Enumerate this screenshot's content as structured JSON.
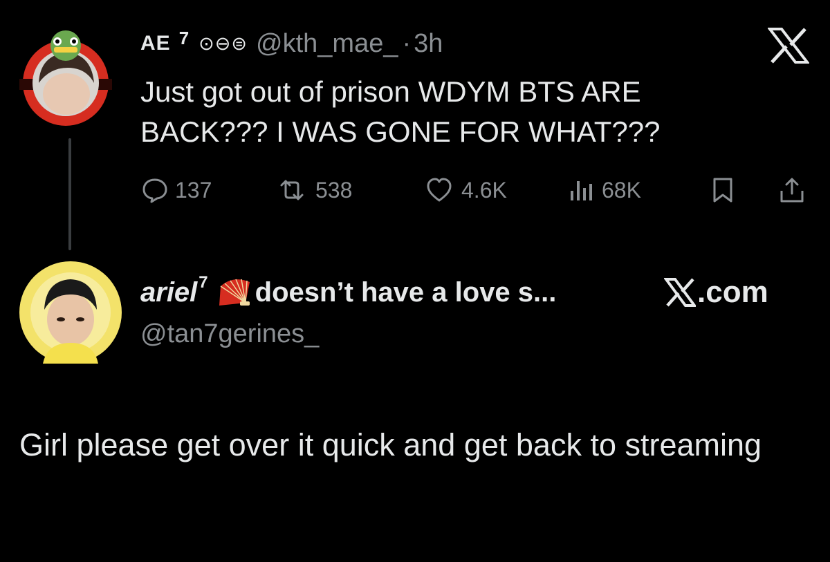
{
  "tweet_main": {
    "name": "AE",
    "name_suffix": "7",
    "name_symbols": "⊙⊖⊜",
    "handle": "@kth_mae_",
    "time": "3h",
    "text": "Just got out of prison WDYM BTS ARE BACK??? I WAS GONE FOR WHAT???",
    "replies": "137",
    "reposts": "538",
    "likes": "4.6K",
    "views": "68K"
  },
  "tweet_reply": {
    "display_name": "ariel",
    "name_superscript": "7",
    "name_tagline": "doesn’t have a love s...",
    "brand": ".com",
    "handle": "@tan7gerines_",
    "text": "Girl please get over it quick and get back to streaming"
  },
  "icons": {
    "x_logo": "x-logo-icon",
    "reply": "reply-icon",
    "repost": "repost-icon",
    "like": "heart-icon",
    "views": "views-icon",
    "bookmark": "bookmark-icon",
    "share": "share-icon",
    "fan": "fan-emoji-icon"
  },
  "colors": {
    "background": "#000000",
    "text_primary": "#e7e9ea",
    "text_secondary": "#8b8f93",
    "thread_line": "#3a3d40",
    "avatar1_ring": "#d62d20",
    "avatar2_ring": "#f3e26a"
  }
}
